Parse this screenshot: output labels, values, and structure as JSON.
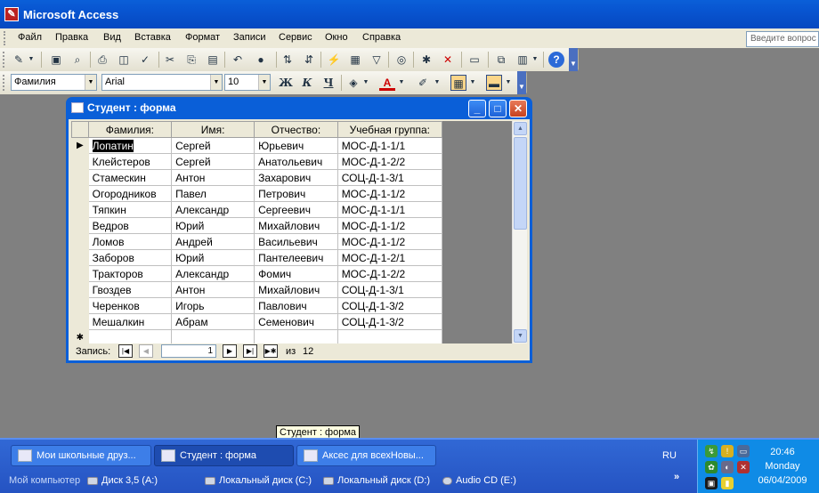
{
  "window": {
    "title": "Microsoft Access"
  },
  "menu": {
    "items": [
      {
        "label": "Файл"
      },
      {
        "label": "Правка"
      },
      {
        "label": "Вид"
      },
      {
        "label": "Вставка"
      },
      {
        "label": "Формат"
      },
      {
        "label": "Записи"
      },
      {
        "label": "Сервис"
      },
      {
        "label": "Окно"
      },
      {
        "label": "Справка"
      }
    ]
  },
  "help": {
    "placeholder": "Введите вопрос"
  },
  "format_toolbar": {
    "field": "Фамилия",
    "font": "Arial",
    "size": "10",
    "bold": "Ж",
    "italic": "К",
    "underline": "Ч",
    "font_color_letter": "A"
  },
  "form": {
    "title": "Студент : форма",
    "columns": [
      "Фамилия:",
      "Имя:",
      "Отчество:",
      "Учебная группа:"
    ],
    "rows": [
      [
        "Лопатин",
        "Сергей",
        "Юрьевич",
        "МОС-Д-1-1/1"
      ],
      [
        "Клейстеров",
        "Сергей",
        "Анатольевич",
        "МОС-Д-1-2/2"
      ],
      [
        "Стамескин",
        "Антон",
        "Захарович",
        "СОЦ-Д-1-3/1"
      ],
      [
        "Огородников",
        "Павел",
        "Петрович",
        "МОС-Д-1-1/2"
      ],
      [
        "Тяпкин",
        "Александр",
        "Сергеевич",
        "МОС-Д-1-1/1"
      ],
      [
        "Ведров",
        "Юрий",
        "Михайлович",
        "МОС-Д-1-1/2"
      ],
      [
        "Ломов",
        "Андрей",
        "Васильевич",
        "МОС-Д-1-1/2"
      ],
      [
        "Заборов",
        "Юрий",
        "Пантелеевич",
        "МОС-Д-1-2/1"
      ],
      [
        "Тракторов",
        "Александр",
        "Фомич",
        "МОС-Д-1-2/2"
      ],
      [
        "Гвоздев",
        "Антон",
        "Михайлович",
        "СОЦ-Д-1-3/1"
      ],
      [
        "Черенков",
        "Игорь",
        "Павлович",
        "СОЦ-Д-1-3/2"
      ],
      [
        "Мешалкин",
        "Абрам",
        "Семенович",
        "СОЦ-Д-1-3/2"
      ]
    ],
    "current_row_marker": "▶",
    "new_row_marker": "✱",
    "nav": {
      "label": "Запись:",
      "current": "1",
      "of_label": "из",
      "total": "12"
    }
  },
  "tooltip": "Студент : форма",
  "taskbar": {
    "tasks": [
      {
        "label": "Мои школьные друз..."
      },
      {
        "label": "Студент : форма"
      },
      {
        "label": "Аксес для всехНовы..."
      }
    ],
    "drives_label": "Мой компьютер",
    "drives": [
      {
        "label": "Диск 3,5 (A:)"
      },
      {
        "label": "Локальный диск (C:)"
      },
      {
        "label": "Локальный диск (D:)"
      },
      {
        "label": "Audio CD (E:)"
      }
    ],
    "lang": "RU",
    "expand": "»",
    "clock": {
      "time": "20:46",
      "day": "Monday",
      "date": "06/04/2009"
    }
  }
}
